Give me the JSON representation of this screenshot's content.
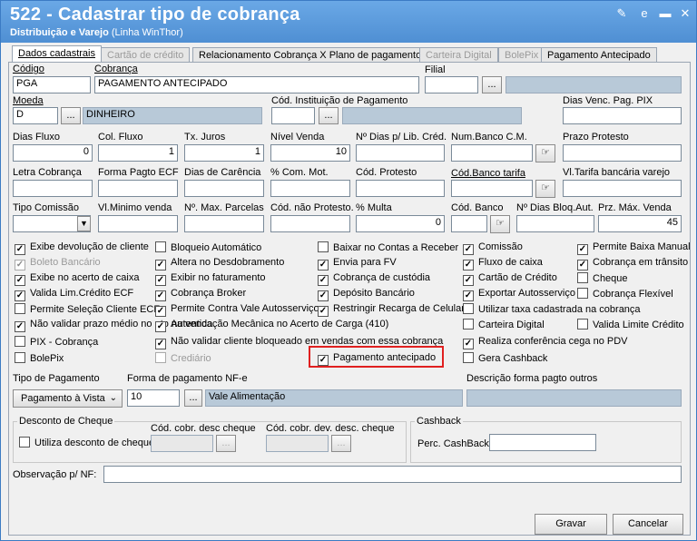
{
  "window": {
    "title": "522 - Cadastrar tipo de cobrança",
    "subtitle_bold": "Distribuição e Varejo",
    "subtitle_light": " (Linha WinThor)"
  },
  "tabs": [
    {
      "label": "Dados cadastrais",
      "state": "active"
    },
    {
      "label": "Cartão de crédito",
      "state": "disabled"
    },
    {
      "label": "Relacionamento Cobrança X Plano de pagamento",
      "state": "normal"
    },
    {
      "label": "Carteira Digital",
      "state": "disabled"
    },
    {
      "label": "BolePix",
      "state": "disabled"
    },
    {
      "label": "Pagamento Antecipado",
      "state": "normal"
    }
  ],
  "fields": {
    "codigo": {
      "label": "Código",
      "value": "PGA"
    },
    "cobranca": {
      "label": "Cobrança",
      "value": "PAGAMENTO ANTECIPADO"
    },
    "filial": {
      "label": "Filial",
      "value": ""
    },
    "moeda": {
      "label": "Moeda",
      "value": "D",
      "desc": "DINHEIRO"
    },
    "cod_instituicao": {
      "label": "Cód. Instituição de Pagamento",
      "value": ""
    },
    "dias_venc": {
      "label": "Dias Venc. Pag. PIX",
      "value": ""
    },
    "dias_fluxo": {
      "label": "Dias Fluxo",
      "value": "0"
    },
    "col_fluxo": {
      "label": "Col. Fluxo",
      "value": "1"
    },
    "tx_juros": {
      "label": "Tx. Juros",
      "value": "1"
    },
    "nivel_venda": {
      "label": "Nível Venda",
      "value": "10"
    },
    "nr_dias_lib": {
      "label": "Nº Dias p/ Lib. Créd.",
      "value": ""
    },
    "num_banco_cm": {
      "label": "Num.Banco C.M.",
      "value": ""
    },
    "prazo_protesto": {
      "label": "Prazo Protesto",
      "value": ""
    },
    "letra_cobranca": {
      "label": "Letra Cobrança",
      "value": ""
    },
    "forma_pagto_ecf": {
      "label": "Forma Pagto ECF",
      "value": ""
    },
    "dias_carencia": {
      "label": "Dias de Carência",
      "value": ""
    },
    "com_mot": {
      "label": "% Com. Mot.",
      "value": ""
    },
    "cod_protesto": {
      "label": "Cód. Protesto",
      "value": ""
    },
    "cod_banco_tarifa": {
      "label": "Cód.Banco tarifa",
      "value": ""
    },
    "vl_tarifa": {
      "label": "Vl.Tarifa bancária varejo",
      "value": ""
    },
    "tipo_comissao": {
      "label": "Tipo Comissão",
      "value": ""
    },
    "vl_minimo": {
      "label": "Vl.Minimo venda",
      "value": ""
    },
    "max_parcelas": {
      "label": "Nº. Max. Parcelas",
      "value": ""
    },
    "cod_nao_protesto": {
      "label": "Cód. não Protesto.",
      "value": ""
    },
    "multa": {
      "label": "% Multa",
      "value": "0"
    },
    "cod_banco": {
      "label": "Cód. Banco",
      "value": ""
    },
    "dias_bloq": {
      "label": "Nº Dias Bloq.Aut.",
      "value": ""
    },
    "prz_max_venda": {
      "label": "Prz. Máx. Venda",
      "value": "45"
    }
  },
  "checkboxes": {
    "col1": [
      {
        "label": "Exibe devolução de cliente",
        "checked": true,
        "disabled": false
      },
      {
        "label": "Boleto Bancário",
        "checked": true,
        "disabled": true
      },
      {
        "label": "Exibe no acerto de caixa",
        "checked": true,
        "disabled": false
      },
      {
        "label": "Valida Lim.Crédito ECF",
        "checked": true,
        "disabled": false
      },
      {
        "label": "Permite Seleção Cliente ECF",
        "checked": false,
        "disabled": false
      },
      {
        "label": "Não validar prazo médio no ato na venda",
        "checked": true,
        "disabled": false
      },
      {
        "label": "PIX - Cobrança",
        "checked": false,
        "disabled": false
      },
      {
        "label": "BolePix",
        "checked": false,
        "disabled": false
      }
    ],
    "col2": [
      {
        "label": "Bloqueio Automático",
        "checked": false,
        "disabled": false
      },
      {
        "label": "Altera no Desdobramento",
        "checked": true,
        "disabled": false
      },
      {
        "label": "Exibir no faturamento",
        "checked": true,
        "disabled": false
      },
      {
        "label": "Cobrança Broker",
        "checked": true,
        "disabled": false
      },
      {
        "label": "Permite Contra Vale Autosserviço",
        "checked": true,
        "disabled": false
      },
      {
        "label": "Autenticação Mecânica no Acerto de Carga (410)",
        "checked": true,
        "disabled": false
      },
      {
        "label": "Não validar cliente bloqueado em vendas com essa cobrança",
        "checked": true,
        "disabled": false
      },
      {
        "label": "Crediário",
        "checked": false,
        "disabled": true
      }
    ],
    "col3": [
      {
        "label": "Baixar no Contas a Receber",
        "checked": false,
        "disabled": false
      },
      {
        "label": "Envia para FV",
        "checked": true,
        "disabled": false
      },
      {
        "label": "Cobrança de custódia",
        "checked": true,
        "disabled": false
      },
      {
        "label": "Depósito Bancário",
        "checked": true,
        "disabled": false
      },
      {
        "label": "Restringir Recarga de Celular",
        "checked": true,
        "disabled": false
      },
      {
        "label": "Pagamento antecipado",
        "checked": true,
        "disabled": false
      }
    ],
    "col4": [
      {
        "label": "Comissão",
        "checked": true,
        "disabled": false
      },
      {
        "label": "Fluxo de caixa",
        "checked": true,
        "disabled": false
      },
      {
        "label": "Cartão de Crédito",
        "checked": true,
        "disabled": false
      },
      {
        "label": "Exportar Autosserviço",
        "checked": true,
        "disabled": false
      },
      {
        "label": "Utilizar taxa cadastrada na cobrança",
        "checked": false,
        "disabled": false
      },
      {
        "label": "Carteira Digital",
        "checked": false,
        "disabled": false
      },
      {
        "label": "Realiza conferência cega no PDV",
        "checked": true,
        "disabled": false
      },
      {
        "label": "Gera Cashback",
        "checked": false,
        "disabled": false
      }
    ],
    "col5": [
      {
        "label": "Permite Baixa Manual",
        "checked": true,
        "disabled": false
      },
      {
        "label": "Cobrança em trânsito",
        "checked": true,
        "disabled": false
      },
      {
        "label": "Cheque",
        "checked": false,
        "disabled": false
      },
      {
        "label": "Cobrança Flexível",
        "checked": false,
        "disabled": false
      },
      {
        "label": "Valida Limite Crédito",
        "checked": false,
        "disabled": false
      }
    ]
  },
  "payment": {
    "tipo_label": "Tipo de Pagamento",
    "tipo_value": "Pagamento à Vista",
    "forma_label": "Forma de pagamento NF-e",
    "forma_code": "10",
    "forma_desc": "Vale Alimentação",
    "desc_outros_label": "Descrição forma pagto outros",
    "desc_outros_value": ""
  },
  "desconto": {
    "group_label": "Desconto de Cheque",
    "utiliza_label": "Utiliza desconto de cheque",
    "cod_desc_label": "Cód. cobr. desc cheque",
    "cod_dev_label": "Cód. cobr. dev. desc. cheque"
  },
  "cashback": {
    "group_label": "Cashback",
    "perc_label": "Perc. CashBack",
    "perc_value": ""
  },
  "observacao": {
    "label": "Observação p/ NF:",
    "value": ""
  },
  "buttons": {
    "ellipsis": "...",
    "gravar": "Gravar",
    "cancelar": "Cancelar"
  }
}
